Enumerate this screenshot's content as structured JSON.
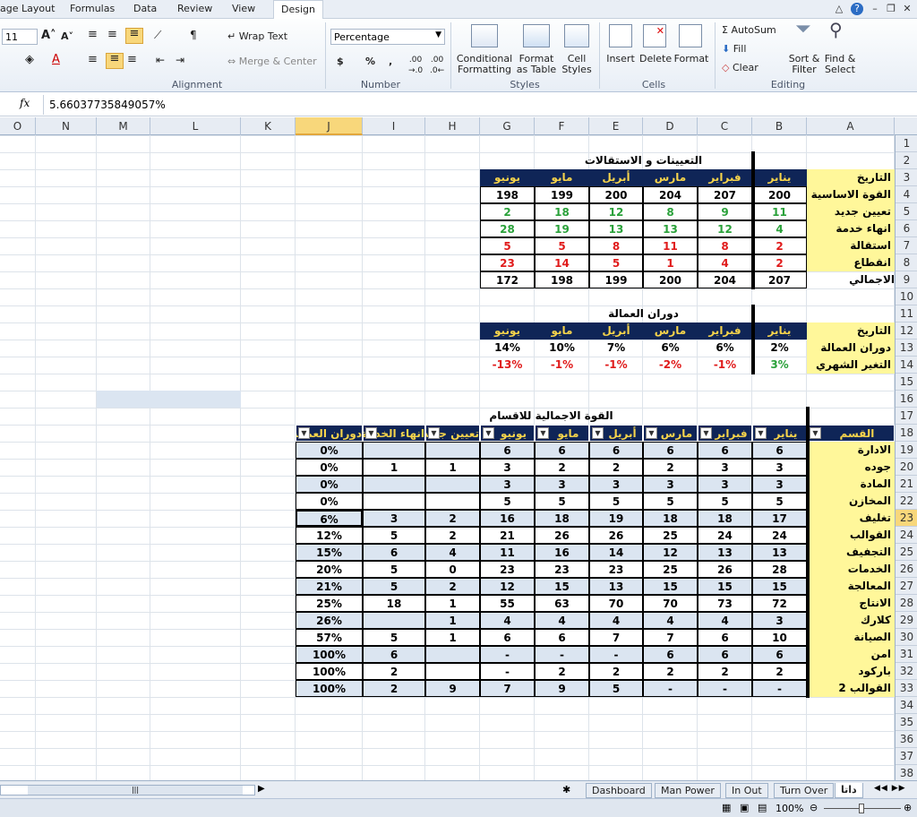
{
  "ribbon_tabs": [
    "age Layout",
    "Formulas",
    "Data",
    "Review",
    "View",
    "Design"
  ],
  "ribbon": {
    "font_size": "11",
    "wrap_text": "Wrap Text",
    "merge_center": "Merge & Center",
    "number_format": "Percentage",
    "conditional": "Conditional Formatting",
    "format_table": "Format as Table",
    "cell_styles": "Cell Styles",
    "insert": "Insert",
    "delete": "Delete",
    "format": "Format",
    "autosum": "AutoSum",
    "fill": "Fill",
    "clear": "Clear",
    "sort": "Sort & Filter",
    "find": "Find & Select",
    "groups": [
      "Alignment",
      "Number",
      "Styles",
      "Cells",
      "Editing"
    ],
    "currency": "$",
    "percent": "%",
    "comma": ","
  },
  "formula": {
    "fx": "fx",
    "value": "5.66037735849057%"
  },
  "columns": [
    "O",
    "N",
    "M",
    "L",
    "K",
    "J",
    "I",
    "H",
    "G",
    "F",
    "E",
    "D",
    "C",
    "B",
    "A"
  ],
  "rows": [
    "1",
    "2",
    "3",
    "4",
    "5",
    "6",
    "7",
    "8",
    "9",
    "10",
    "11",
    "12",
    "13",
    "14",
    "15",
    "16",
    "17",
    "18",
    "19",
    "20",
    "21",
    "22",
    "23",
    "24",
    "25",
    "26",
    "27",
    "28",
    "29",
    "30",
    "31",
    "32",
    "33",
    "34",
    "35",
    "36",
    "37",
    "38"
  ],
  "t1": {
    "title": "التعيينات و الاستقالات",
    "corner": "التاريخ",
    "months": [
      "يناير",
      "فبراير",
      "مارس",
      "أبريل",
      "مايو",
      "يونيو"
    ],
    "rows": [
      {
        "label": "القوة الاساسية",
        "v": [
          "200",
          "207",
          "204",
          "200",
          "199",
          "198"
        ],
        "c": "black"
      },
      {
        "label": "تعيين جديد",
        "v": [
          "11",
          "9",
          "8",
          "12",
          "18",
          "2"
        ],
        "c": "green"
      },
      {
        "label": "انهاء خدمة",
        "v": [
          "4",
          "12",
          "13",
          "13",
          "19",
          "28"
        ],
        "c": "green"
      },
      {
        "label": "استقالة",
        "v": [
          "2",
          "8",
          "11",
          "8",
          "5",
          "5"
        ],
        "c": "red"
      },
      {
        "label": "انقطاع",
        "v": [
          "2",
          "4",
          "1",
          "5",
          "14",
          "23"
        ],
        "c": "red"
      },
      {
        "label": "الاجمالي",
        "v": [
          "207",
          "204",
          "200",
          "199",
          "198",
          "172"
        ],
        "c": "black"
      }
    ]
  },
  "t2": {
    "title": "دوران العمالة",
    "corner": "التاريخ",
    "months": [
      "يناير",
      "فبراير",
      "مارس",
      "أبريل",
      "مايو",
      "يونيو"
    ],
    "turnover_label": "دوران العمالة",
    "turnover": [
      "2%",
      "6%",
      "6%",
      "7%",
      "10%",
      "14%"
    ],
    "change_label": "التغير الشهري",
    "change": [
      "3%",
      "-1%",
      "-2%",
      "-1%",
      "-1%",
      "-13%"
    ]
  },
  "t3": {
    "title": "القوة الاجمالية للاقسام",
    "headers": [
      "القسم",
      "يناير",
      "فبراير",
      "مارس",
      "أبريل",
      "مايو",
      "يونيو",
      "تعيين جديد",
      "انهاء الخدمة",
      "دوران العمالة"
    ],
    "rows": [
      {
        "d": "الادارة",
        "v": [
          "6",
          "6",
          "6",
          "6",
          "6",
          "6",
          "",
          "",
          ""
        ],
        "t": "0%"
      },
      {
        "d": "جوده",
        "v": [
          "3",
          "3",
          "2",
          "2",
          "2",
          "3",
          "1",
          "1"
        ],
        "t": "0%"
      },
      {
        "d": "المادة",
        "v": [
          "3",
          "3",
          "3",
          "3",
          "3",
          "3",
          "",
          ""
        ],
        "t": "0%"
      },
      {
        "d": "المخازن",
        "v": [
          "5",
          "5",
          "5",
          "5",
          "5",
          "5",
          "",
          ""
        ],
        "t": "0%"
      },
      {
        "d": "تغليف",
        "v": [
          "17",
          "18",
          "18",
          "19",
          "18",
          "16",
          "2",
          "3"
        ],
        "t": "6%"
      },
      {
        "d": "القوالب",
        "v": [
          "24",
          "24",
          "25",
          "26",
          "26",
          "21",
          "2",
          "5"
        ],
        "t": "12%"
      },
      {
        "d": "التجفيف",
        "v": [
          "13",
          "13",
          "12",
          "14",
          "16",
          "11",
          "4",
          "6"
        ],
        "t": "15%"
      },
      {
        "d": "الخدمات",
        "v": [
          "28",
          "26",
          "25",
          "23",
          "23",
          "23",
          "0",
          "5"
        ],
        "t": "20%"
      },
      {
        "d": "المعالجة",
        "v": [
          "15",
          "15",
          "15",
          "13",
          "15",
          "12",
          "2",
          "5"
        ],
        "t": "21%"
      },
      {
        "d": "الانتاج",
        "v": [
          "72",
          "73",
          "70",
          "70",
          "63",
          "55",
          "1",
          "18"
        ],
        "t": "25%"
      },
      {
        "d": "كلارك",
        "v": [
          "3",
          "4",
          "4",
          "4",
          "4",
          "4",
          "1",
          ""
        ],
        "t": "26%"
      },
      {
        "d": "الصيانة",
        "v": [
          "10",
          "6",
          "7",
          "7",
          "6",
          "6",
          "1",
          "5"
        ],
        "t": "57%"
      },
      {
        "d": "امن",
        "v": [
          "6",
          "6",
          "6",
          "-",
          "-",
          "-",
          "",
          "6"
        ],
        "t": "100%"
      },
      {
        "d": "باركود",
        "v": [
          "2",
          "2",
          "2",
          "2",
          "2",
          "-",
          "",
          "2"
        ],
        "t": "100%"
      },
      {
        "d": "القوالب 2",
        "v": [
          "-",
          "-",
          "-",
          "5",
          "9",
          "7",
          "9",
          "2"
        ],
        "t": "100%"
      }
    ]
  },
  "sheets": [
    "Dashboard",
    "Man Power",
    "In Out",
    "Turn Over",
    "داتا"
  ],
  "status": {
    "zoom": "100%"
  }
}
